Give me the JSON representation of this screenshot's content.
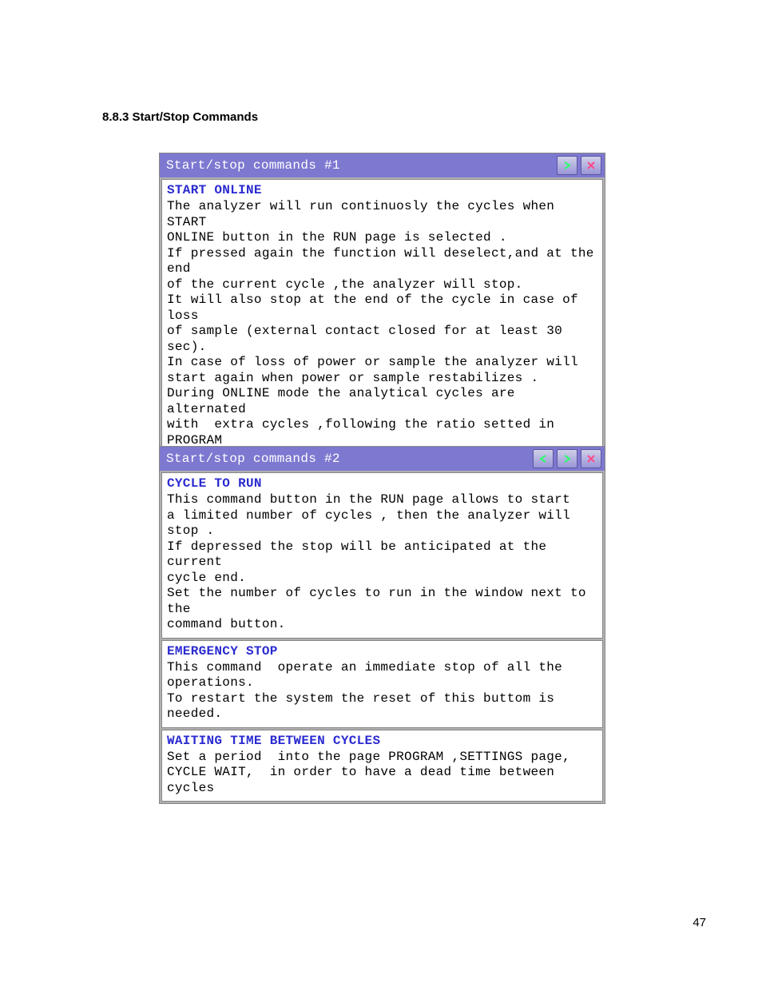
{
  "heading": "8.8.3 Start/Stop Commands",
  "page_number": "47",
  "panel1": {
    "title": "Start/stop commands  #1",
    "blocks": [
      {
        "title": "START ONLINE",
        "body": "The analyzer will run continuosly the cycles when START\nONLINE button in the RUN page is selected .\nIf pressed again the function will deselect,and at the end\nof the current cycle ,the analyzer will stop.\nIt will also stop at the end of the cycle in case of loss\nof sample (external contact closed for at least 30 sec).\nIn case of loss of power or sample the analyzer will\nstart again when power or sample restabilizes .\nDuring ONLINE mode the analytical cycles are alternated\nwith  extra cycles ,following the ratio setted in PROGRAM\npage - SETTINGS page - CYCLES RATIO ."
      }
    ]
  },
  "panel2": {
    "title": "Start/stop commands  #2",
    "blocks": [
      {
        "title": "CYCLE TO RUN",
        "body": "This command button in the RUN page allows to start\na limited number of cycles , then the analyzer will stop .\nIf depressed the stop will be anticipated at the current\ncycle end.\nSet the number of cycles to run in the window next to the\ncommand button."
      },
      {
        "title": "EMERGENCY STOP",
        "body": "This command  operate an immediate stop of all the\noperations.\nTo restart the system the reset of this buttom is needed."
      },
      {
        "title": "WAITING TIME BETWEEN CYCLES",
        "body": "Set a period  into the page PROGRAM ,SETTINGS page,\nCYCLE WAIT,  in order to have a dead time between cycles"
      }
    ]
  }
}
